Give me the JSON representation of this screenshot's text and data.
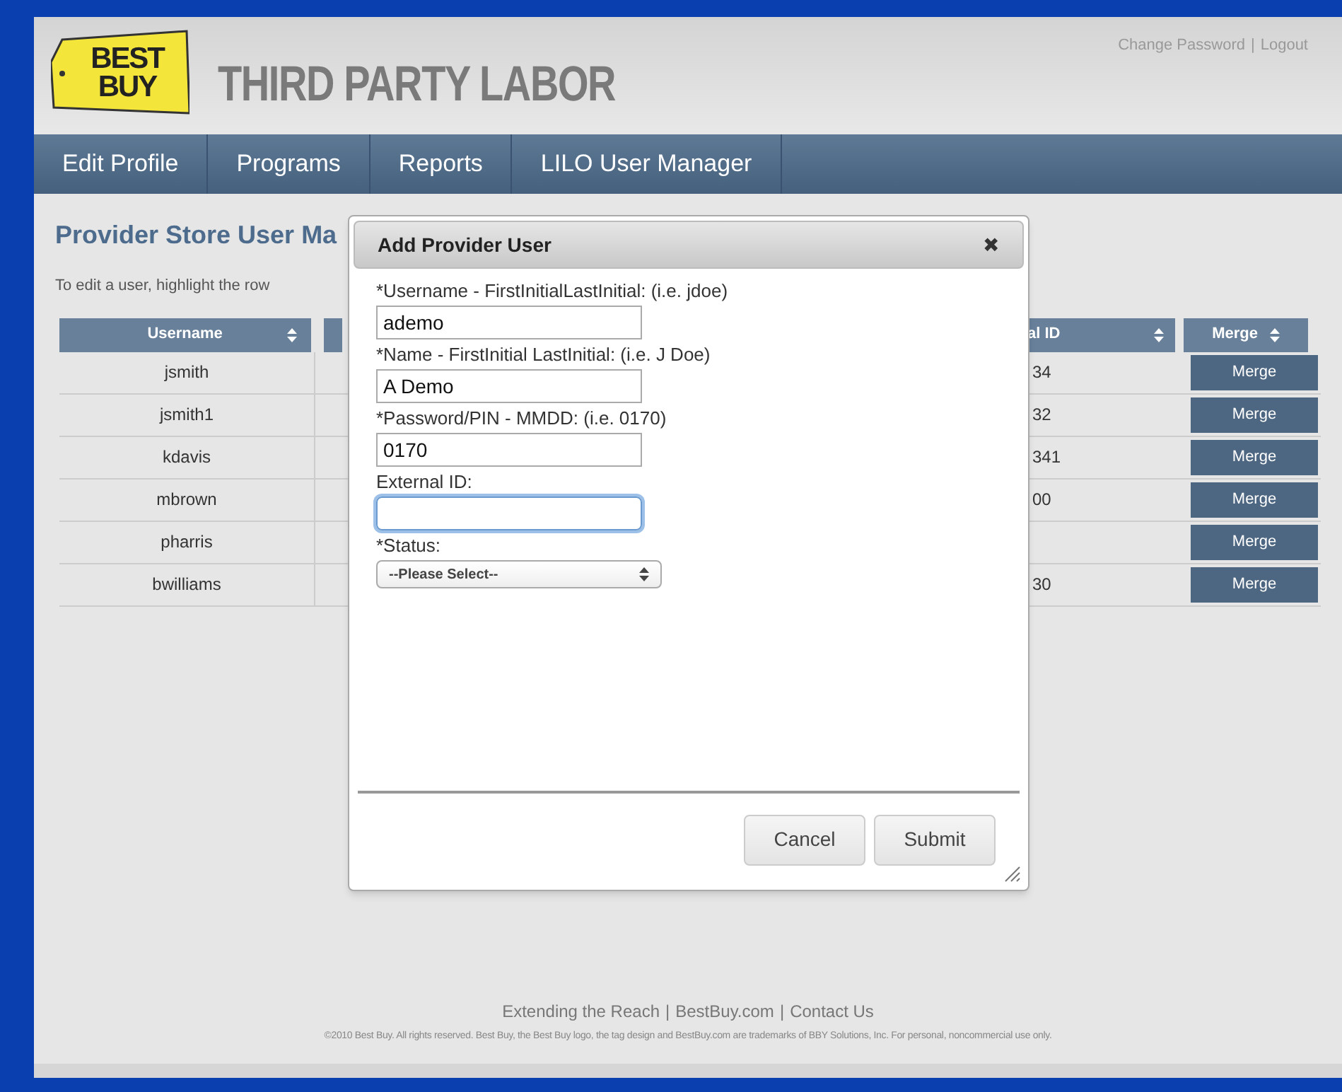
{
  "header": {
    "logo": [
      "BEST",
      "BUY"
    ],
    "title": "THIRD PARTY LABOR",
    "links": [
      "Change Password",
      "Logout"
    ],
    "separator": "|"
  },
  "nav": [
    {
      "label": "Edit Profile"
    },
    {
      "label": "Programs"
    },
    {
      "label": "Reports"
    },
    {
      "label": "LILO User Manager"
    }
  ],
  "page": {
    "heading": "Provider Store User Ma",
    "instructions": "To edit a user, highlight the row"
  },
  "table": {
    "columns": [
      "Username",
      "",
      "al ID",
      "Merge"
    ],
    "rows": [
      {
        "username": "jsmith",
        "external_id": "34",
        "action": "Merge"
      },
      {
        "username": "jsmith1",
        "external_id": "32",
        "action": "Merge"
      },
      {
        "username": "kdavis",
        "external_id": "341",
        "action": "Merge"
      },
      {
        "username": "mbrown",
        "external_id": "00",
        "action": "Merge"
      },
      {
        "username": "pharris",
        "action": "Merge"
      },
      {
        "username": "bwilliams",
        "external_id": "30",
        "action": "Merge"
      }
    ]
  },
  "dialog": {
    "title": "Add Provider User",
    "close": "✖",
    "fields": [
      {
        "kind": "text",
        "label": "*Username - FirstInitialLastInitial: (i.e. jdoe)",
        "value": "ademo",
        "focused": false
      },
      {
        "kind": "text",
        "label": "*Name - FirstInitial LastInitial: (i.e. J Doe)",
        "value": "A Demo",
        "focused": false
      },
      {
        "kind": "text",
        "label": "*Password/PIN - MMDD: (i.e. 0170)",
        "value": "0170",
        "focused": false
      },
      {
        "kind": "text",
        "label": "External ID:",
        "focused": true
      },
      {
        "kind": "select",
        "label": "*Status:",
        "value": "--Please Select--"
      }
    ],
    "buttons": [
      "Cancel",
      "Submit"
    ]
  },
  "footer": {
    "links": [
      "Extending the Reach",
      "BestBuy.com",
      "Contact Us"
    ],
    "separator": "|",
    "copyright": "©2010 Best Buy. All rights reserved. Best Buy, the Best Buy logo, the tag design and BestBuy.com are trademarks of BBY Solutions, Inc. For personal, noncommercial use only."
  }
}
